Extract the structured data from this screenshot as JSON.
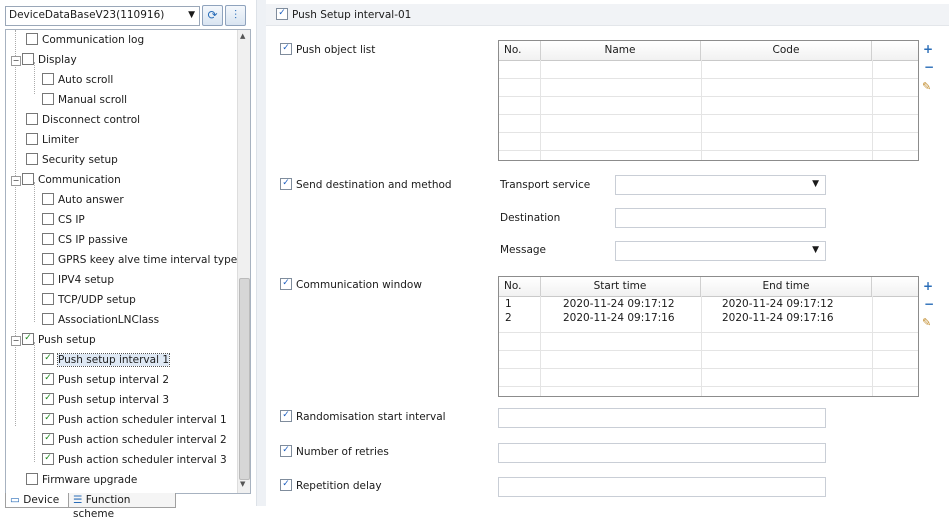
{
  "device_selector": {
    "value": "DeviceDataBaseV23(110916)"
  },
  "tree": {
    "items": [
      {
        "label": "Communication log",
        "checked": false
      },
      {
        "label": "Display",
        "checked": false
      },
      {
        "label": "Auto scroll",
        "checked": false
      },
      {
        "label": "Manual scroll",
        "checked": false
      },
      {
        "label": "Disconnect control",
        "checked": false
      },
      {
        "label": "Limiter",
        "checked": false
      },
      {
        "label": "Security setup",
        "checked": false
      },
      {
        "label": "Communication",
        "checked": false
      },
      {
        "label": "Auto answer",
        "checked": false
      },
      {
        "label": "CS IP",
        "checked": false
      },
      {
        "label": "CS IP passive",
        "checked": false
      },
      {
        "label": "GPRS keey alve time interval type",
        "checked": false
      },
      {
        "label": "IPV4 setup",
        "checked": false
      },
      {
        "label": "TCP/UDP setup",
        "checked": false
      },
      {
        "label": "AssociationLNClass",
        "checked": false
      },
      {
        "label": "Push setup",
        "checked": true
      },
      {
        "label": "Push setup interval 1",
        "checked": true
      },
      {
        "label": "Push setup interval 2",
        "checked": true
      },
      {
        "label": "Push setup interval 3",
        "checked": true
      },
      {
        "label": "Push action scheduler interval 1",
        "checked": true
      },
      {
        "label": "Push action scheduler interval 2",
        "checked": true
      },
      {
        "label": "Push action scheduler interval 3",
        "checked": true
      },
      {
        "label": "Firmware upgrade",
        "checked": false
      }
    ]
  },
  "bottom_tabs": {
    "device": "Device",
    "function_scheme": "Function scheme"
  },
  "header": {
    "title": "Push Setup interval-01"
  },
  "push_object_list": {
    "label": "Push object list",
    "columns": [
      "No.",
      "Name",
      "Code"
    ],
    "rows": []
  },
  "send_destination": {
    "label": "Send destination and method",
    "transport_service_label": "Transport service",
    "transport_service_value": "",
    "destination_label": "Destination",
    "destination_value": "",
    "message_label": "Message",
    "message_value": ""
  },
  "communication_window": {
    "label": "Communication window",
    "columns": [
      "No.",
      "Start time",
      "End time"
    ],
    "rows": [
      [
        "1",
        "2020-11-24 09:17:12",
        "2020-11-24 09:17:12"
      ],
      [
        "2",
        "2020-11-24 09:17:16",
        "2020-11-24 09:17:16"
      ]
    ]
  },
  "randomisation": {
    "label": "Randomisation start interval",
    "value": ""
  },
  "retries": {
    "label": "Number of retries",
    "value": ""
  },
  "repetition": {
    "label": "Repetition delay",
    "value": ""
  },
  "colors": {
    "accent": "#2a6db8",
    "header_bg": "#f1f3f6",
    "check_green": "#1e8a1e"
  }
}
